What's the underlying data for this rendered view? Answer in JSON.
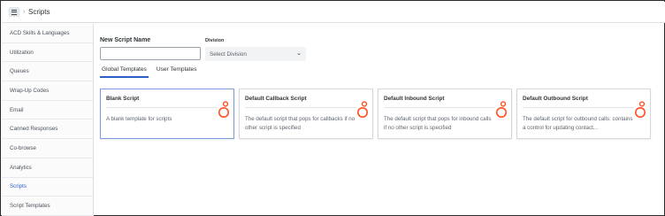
{
  "header": {
    "separator": "›",
    "title": "Scripts"
  },
  "sidebar": {
    "items": [
      {
        "label": "ACD Skills & Languages",
        "active": false
      },
      {
        "label": "Utilization",
        "active": false
      },
      {
        "label": "Queues",
        "active": false
      },
      {
        "label": "Wrap-Up Codes",
        "active": false
      },
      {
        "label": "Email",
        "active": false
      },
      {
        "label": "Canned Responses",
        "active": false
      },
      {
        "label": "Co-browse",
        "active": false
      },
      {
        "label": "Analytics",
        "active": false
      },
      {
        "label": "Scripts",
        "active": true
      },
      {
        "label": "Script Templates",
        "active": false
      }
    ]
  },
  "form": {
    "name_label": "New Script Name",
    "name_value": "",
    "division_label": "Division",
    "division_placeholder": "Select Division"
  },
  "tabs": [
    {
      "label": "Global Templates",
      "active": true
    },
    {
      "label": "User Templates",
      "active": false
    }
  ],
  "cards": [
    {
      "title": "Blank Script",
      "description": "A blank template for scripts",
      "selected": true
    },
    {
      "title": "Default Callback Script",
      "description": "The default script that pops for callbacks if no other script is specified",
      "selected": false
    },
    {
      "title": "Default Inbound Script",
      "description": "The default script that pops for inbound calls if no other script is specified",
      "selected": false
    },
    {
      "title": "Default Outbound Script",
      "description": "The default script for outbound calls: contains a control for updating contact...",
      "selected": false
    }
  ],
  "colors": {
    "accent": "#2a60c8",
    "brand_icon": "#ff4f1f"
  },
  "icons": {
    "menu": "hamburger-menu-icon",
    "dropdown": "chevron-down-icon",
    "card": "genesys-logo-icon"
  }
}
